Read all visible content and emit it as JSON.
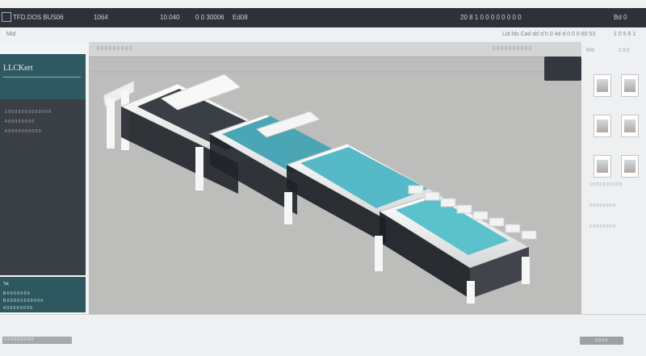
{
  "appbar": {
    "title": "TFD.DOS BUS06",
    "menu": [
      "1064",
      "10.040",
      "0 0 30006",
      "Ed08"
    ],
    "right_text": "20 8 1 0 0 0 0 0 0 0 0",
    "right_icon": "Bd 0"
  },
  "subbar": {
    "left": "Mid",
    "center": "Lid fdx Cad dd d h 0 4d d 0 0 0 60 53",
    "right": "1 0 5 6 1"
  },
  "left": {
    "title": "LLCKert",
    "items": [
      "1 0 0 0 0 0 0 0 0 0 0 0 0 0",
      "4 0 0 0 0 0 0 0 0",
      "4 0 0 0 0 0 0 0 0 0 0"
    ],
    "bottom_title": "Tat",
    "bottom_items": [
      "B 0 0 0 0 0 0 0",
      "B 0 0 0 0 0 0 0 0 0 0 0",
      "4 0 0 0 0 0 0 0 0"
    ]
  },
  "canvasbar": {
    "left": "0 0 0 0 0 0 0 0 0",
    "right": "0 0 0 0 0 0 0 0 0 0"
  },
  "right": {
    "header": "000",
    "header_action": "1 0 0",
    "labels": [
      "1 0 0 0 0 0 0 0 0 0",
      "0 0 0 0 0 0 0 0",
      "1 0 0 0 0 0 0 0"
    ]
  },
  "status": {
    "progress_label": "1 0 0 0 0 0 0 0 0",
    "progress": 0.28,
    "ok_label": "0 0 0 0"
  }
}
